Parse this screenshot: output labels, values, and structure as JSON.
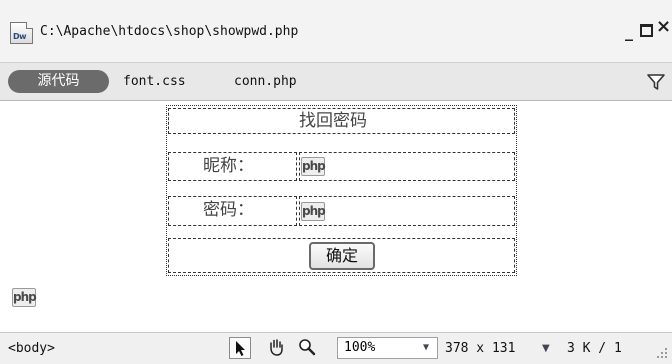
{
  "window": {
    "file_icon_label": "Dw",
    "title": "C:\\Apache\\htdocs\\shop\\showpwd.php",
    "minimize_glyph": "_",
    "close_glyph": "×"
  },
  "filebar": {
    "source_code_label": "源代码",
    "files": [
      "font.css",
      "conn.php"
    ],
    "filter_icon": "funnel-icon"
  },
  "form": {
    "heading": "找回密码",
    "rows": [
      {
        "label": "昵称：",
        "php_badge": "php"
      },
      {
        "label": "密码：",
        "php_badge": "php"
      }
    ],
    "confirm_label": "确定",
    "php_marker": "php"
  },
  "statusbar": {
    "tag": "<body>",
    "tools": [
      "pointer-tool-icon",
      "hand-tool-icon",
      "zoom-tool-icon"
    ],
    "zoom": "100%",
    "window_size": "378 x 131",
    "download_size": "3 K / 1"
  }
}
